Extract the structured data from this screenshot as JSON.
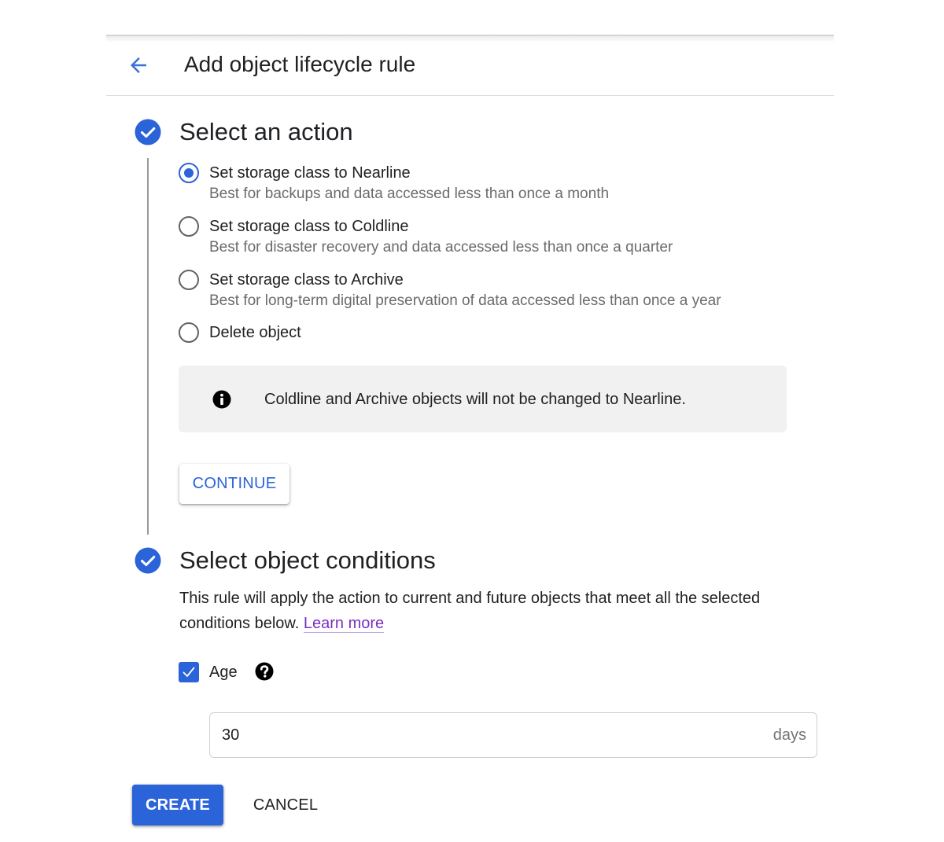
{
  "header": {
    "title": "Add object lifecycle rule",
    "back_icon": "arrow-left-icon"
  },
  "colors": {
    "accent": "#2b63d9",
    "link": "#7b2fbf",
    "info_bg": "#f1f1f1",
    "secondary_text": "#6b6b6b"
  },
  "step1": {
    "title": "Select an action",
    "status_icon": "check-circle-icon",
    "options": [
      {
        "label": "Set storage class to Nearline",
        "description": "Best for backups and data accessed less than once a month",
        "selected": true
      },
      {
        "label": "Set storage class to Coldline",
        "description": "Best for disaster recovery and data accessed less than once a quarter",
        "selected": false
      },
      {
        "label": "Set storage class to Archive",
        "description": "Best for long-term digital preservation of data accessed less than once a year",
        "selected": false
      },
      {
        "label": "Delete object",
        "description": "",
        "selected": false
      }
    ],
    "info": {
      "icon": "info-icon",
      "text": "Coldline and Archive objects will not be changed to Nearline."
    },
    "continue_label": "CONTINUE"
  },
  "step2": {
    "title": "Select object conditions",
    "status_icon": "check-circle-icon",
    "description": "This rule will apply the action to current and future objects that meet all the selected conditions below.",
    "learn_more": "Learn more",
    "age": {
      "label": "Age",
      "checked": true,
      "help_icon": "help-icon",
      "value": "30",
      "suffix": "days"
    }
  },
  "actions": {
    "create_label": "CREATE",
    "cancel_label": "CANCEL"
  }
}
